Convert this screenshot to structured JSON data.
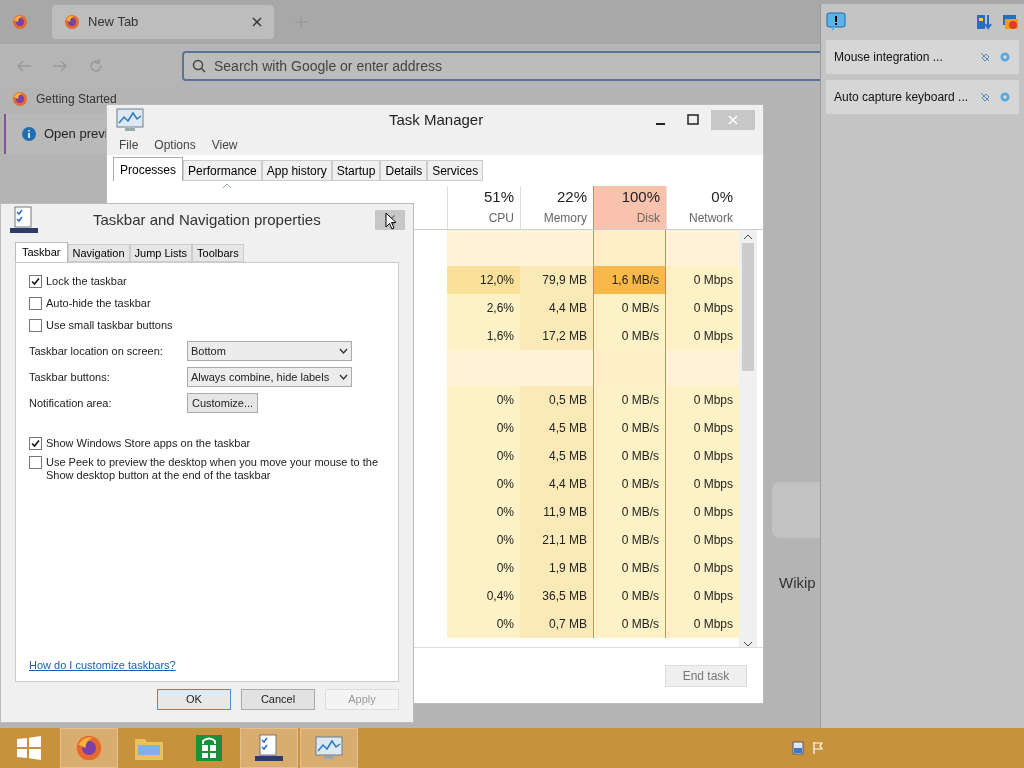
{
  "browser": {
    "tab": "New Tab",
    "address_placeholder": "Search with Google or enter address",
    "bookmark": "Getting Started",
    "notice": "Open previ",
    "tile_label": "Wikip"
  },
  "task_manager": {
    "title": "Task Manager",
    "menu": [
      "File",
      "Options",
      "View"
    ],
    "tabs": [
      {
        "label": "Processes",
        "selected": true
      },
      {
        "label": "Performance",
        "selected": false
      },
      {
        "label": "App history",
        "selected": false
      },
      {
        "label": "Startup",
        "selected": false
      },
      {
        "label": "Details",
        "selected": false
      },
      {
        "label": "Services",
        "selected": false
      }
    ],
    "columns": [
      {
        "percent": "51%",
        "label": "CPU",
        "selected": false
      },
      {
        "percent": "22%",
        "label": "Memory",
        "selected": false
      },
      {
        "percent": "100%",
        "label": "Disk",
        "selected": true
      },
      {
        "percent": "0%",
        "label": "Network",
        "selected": false
      }
    ],
    "rows": [
      {
        "kind": "group"
      },
      {
        "kind": "process",
        "busy": true,
        "cells": [
          "12,0%",
          "79,9 MB",
          "1,6 MB/s",
          "0 Mbps"
        ]
      },
      {
        "kind": "process",
        "busy": false,
        "cells": [
          "2,6%",
          "4,4 MB",
          "0 MB/s",
          "0 Mbps"
        ]
      },
      {
        "kind": "process",
        "busy": false,
        "cells": [
          "1,6%",
          "17,2 MB",
          "0 MB/s",
          "0 Mbps"
        ]
      },
      {
        "kind": "group"
      },
      {
        "kind": "process",
        "busy": false,
        "cells": [
          "0%",
          "0,5 MB",
          "0 MB/s",
          "0 Mbps"
        ]
      },
      {
        "kind": "process",
        "busy": false,
        "cells": [
          "0%",
          "4,5 MB",
          "0 MB/s",
          "0 Mbps"
        ]
      },
      {
        "kind": "process",
        "busy": false,
        "cells": [
          "0%",
          "4,5 MB",
          "0 MB/s",
          "0 Mbps"
        ]
      },
      {
        "kind": "process",
        "busy": false,
        "cells": [
          "0%",
          "4,4 MB",
          "0 MB/s",
          "0 Mbps"
        ]
      },
      {
        "kind": "process",
        "busy": false,
        "cells": [
          "0%",
          "11,9 MB",
          "0 MB/s",
          "0 Mbps"
        ]
      },
      {
        "kind": "process",
        "busy": false,
        "cells": [
          "0%",
          "21,1 MB",
          "0 MB/s",
          "0 Mbps"
        ]
      },
      {
        "kind": "process",
        "busy": false,
        "cells": [
          "0%",
          "1,9 MB",
          "0 MB/s",
          "0 Mbps"
        ]
      },
      {
        "kind": "process",
        "busy": false,
        "cells": [
          "0,4%",
          "36,5 MB",
          "0 MB/s",
          "0 Mbps"
        ]
      },
      {
        "kind": "process",
        "busy": false,
        "cells": [
          "0%",
          "0,7 MB",
          "0 MB/s",
          "0 Mbps"
        ]
      }
    ],
    "end_task": {
      "label": "End task",
      "disabled": true
    }
  },
  "dialog": {
    "title": "Taskbar and Navigation properties",
    "tabs": [
      {
        "label": "Taskbar",
        "selected": true
      },
      {
        "label": "Navigation",
        "selected": false
      },
      {
        "label": "Jump Lists",
        "selected": false
      },
      {
        "label": "Toolbars",
        "selected": false
      }
    ],
    "items": [
      {
        "kind": "checkbox",
        "label": "Lock the taskbar",
        "checked": true
      },
      {
        "kind": "checkbox",
        "label": "Auto-hide the taskbar",
        "checked": false
      },
      {
        "kind": "checkbox",
        "label": "Use small taskbar buttons",
        "checked": false
      },
      {
        "kind": "select",
        "label": "Taskbar location on screen:",
        "value": "Bottom"
      },
      {
        "kind": "select",
        "label": "Taskbar buttons:",
        "value": "Always combine, hide labels"
      },
      {
        "kind": "button",
        "label": "Notification area:",
        "value": "Customize..."
      },
      {
        "kind": "checkbox",
        "label": "Show Windows Store apps on the taskbar",
        "checked": true
      },
      {
        "kind": "checkbox",
        "label": "Use Peek to preview the desktop when you move your mouse to the Show desktop button at the end of the taskbar",
        "checked": false
      }
    ],
    "help_link": "How do I customize taskbars?",
    "buttons": [
      {
        "label": "OK",
        "disabled": false
      },
      {
        "label": "Cancel",
        "disabled": false
      },
      {
        "label": "Apply",
        "disabled": true
      }
    ]
  },
  "notifications": [
    {
      "text": "Mouse integration ..."
    },
    {
      "text": "Auto capture keyboard ..."
    }
  ],
  "taskbar": {
    "apps": [
      {
        "kind": "start",
        "open": false
      },
      {
        "kind": "firefox",
        "open": true
      },
      {
        "kind": "explorer",
        "open": false
      },
      {
        "kind": "store",
        "open": false
      },
      {
        "kind": "properties",
        "open": true
      },
      {
        "kind": "taskmgr",
        "open": true
      }
    ]
  }
}
